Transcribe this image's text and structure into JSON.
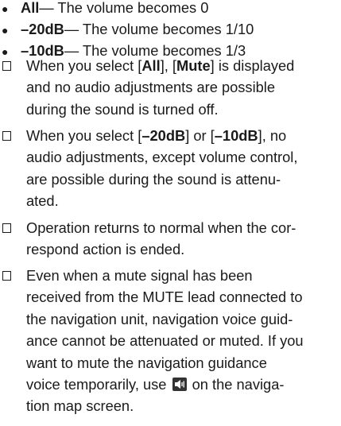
{
  "bullets": [
    {
      "key": "All",
      "desc": " — The volume becomes 0"
    },
    {
      "key": "–20dB",
      "desc": " — The volume becomes 1/10"
    },
    {
      "key": "–10dB",
      "desc": " — The volume becomes 1/3"
    }
  ],
  "notes": {
    "n1": {
      "l1a": "When you select [",
      "l1b": "All",
      "l1c": "], [",
      "l1d": "Mute",
      "l1e": "] is displayed",
      "l2": "and no audio adjustments are possible",
      "l3": "during the sound is turned off."
    },
    "n2": {
      "l1a": "When you select [",
      "l1b": "–20dB",
      "l1c": "] or [",
      "l1d": "–10dB",
      "l1e": "], no",
      "l2": "audio adjustments, except volume control,",
      "l3": "are possible during the sound is attenu-",
      "l4": "ated."
    },
    "n3": {
      "l1": "Operation returns to normal when the cor-",
      "l2": "respond action is ended."
    },
    "n4": {
      "l1": "Even when a mute signal has been",
      "l2": "received from the MUTE lead connected to",
      "l3": "the navigation unit, navigation voice guid-",
      "l4": "ance cannot be attenuated or muted. If you",
      "l5": "want to mute the navigation guidance",
      "l6a": "voice temporarily, use ",
      "l6b": " on the naviga-",
      "l7": "tion map screen."
    }
  },
  "icons": {
    "note_box": "checkbox-square-icon",
    "speaker": "speaker-mute-icon"
  }
}
